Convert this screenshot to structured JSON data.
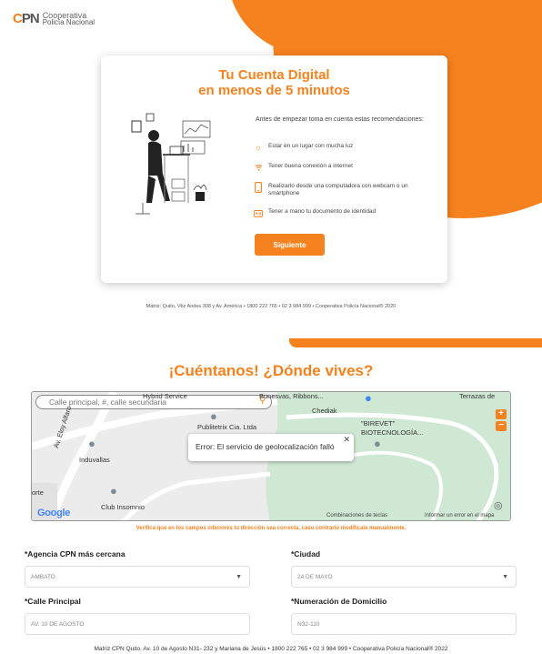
{
  "brand": {
    "mark_c": "C",
    "mark_pn": "PN",
    "line1": "Cooperativa",
    "line2": "Policía Nacional"
  },
  "colors": {
    "accent": "#f5821f",
    "text": "#333333"
  },
  "intro_card": {
    "title_line1": "Tu Cuenta Digital",
    "title_line2": "en menos de 5 minutos",
    "intro": "Antes de empezar toma en cuenta estas recomendaciones:",
    "requirements": [
      {
        "icon": "sun-icon",
        "text": "Estar en un lugar con mucha luz"
      },
      {
        "icon": "wifi-icon",
        "text": "Tener buena conexión a internet"
      },
      {
        "icon": "phone-icon",
        "text": "Realizarlo desde una computadora con webcam o un smartphone"
      },
      {
        "icon": "id-card-icon",
        "text": "Tener a mano tu documento de identidad"
      }
    ],
    "next_button": "Siguiente"
  },
  "footer_top": "Matriz: Quito, Vbz Andes 308 y Av. América • 1800 222 765 • 02 3 984 999 • Cooperativa Policía Nacional® 2020",
  "location": {
    "heading": "¡Cuéntanos! ¿Dónde vives?",
    "map": {
      "search_placeholder": "Calle principal, #, calle secundaria",
      "error_message": "Error: El servicio de geolocalización falló",
      "labels": {
        "street": "Av. Eloy Alfaro",
        "chediak": "Chediak",
        "publitetrix": "Publitetrix Cia. Ltda",
        "induvallas": "Induvallas",
        "birevet1": "\"BIREVET\"",
        "birevet2": "BIOTECNOLOGÍA...",
        "club": "Club Insomnio",
        "orte": "orte",
        "hybrid": "Hybrid Service",
        "bunesvas": "Bunesvas, Ribbons...",
        "terrazas": "Terrazas de"
      },
      "shortcuts": "Combinaciones de teclas",
      "report": "Informar un error en el mapa",
      "google": "Google"
    },
    "verify_note": "Verifica que en los campos inferiores tu dirección sea correcta, caso contrario modifícala manualmente.",
    "fields": {
      "agencia_label": "*Agencia CPN más cercana",
      "agencia_value": "AMBATO",
      "ciudad_label": "*Ciudad",
      "ciudad_value": "24 DE MAYO",
      "calle_label": "*Calle Principal",
      "calle_value": "AV. 10 DE AGOSTO",
      "numero_label": "*Numeración de Domicilio",
      "numero_value": "N32-110"
    }
  },
  "footer_bottom": "Matriz CPN Quito. Av. 10 de Agosto N31- 232 y Mariana de Jesús • 1800 222 765 • 02 3 984 999 • Cooperativa Policía Nacional® 2022"
}
